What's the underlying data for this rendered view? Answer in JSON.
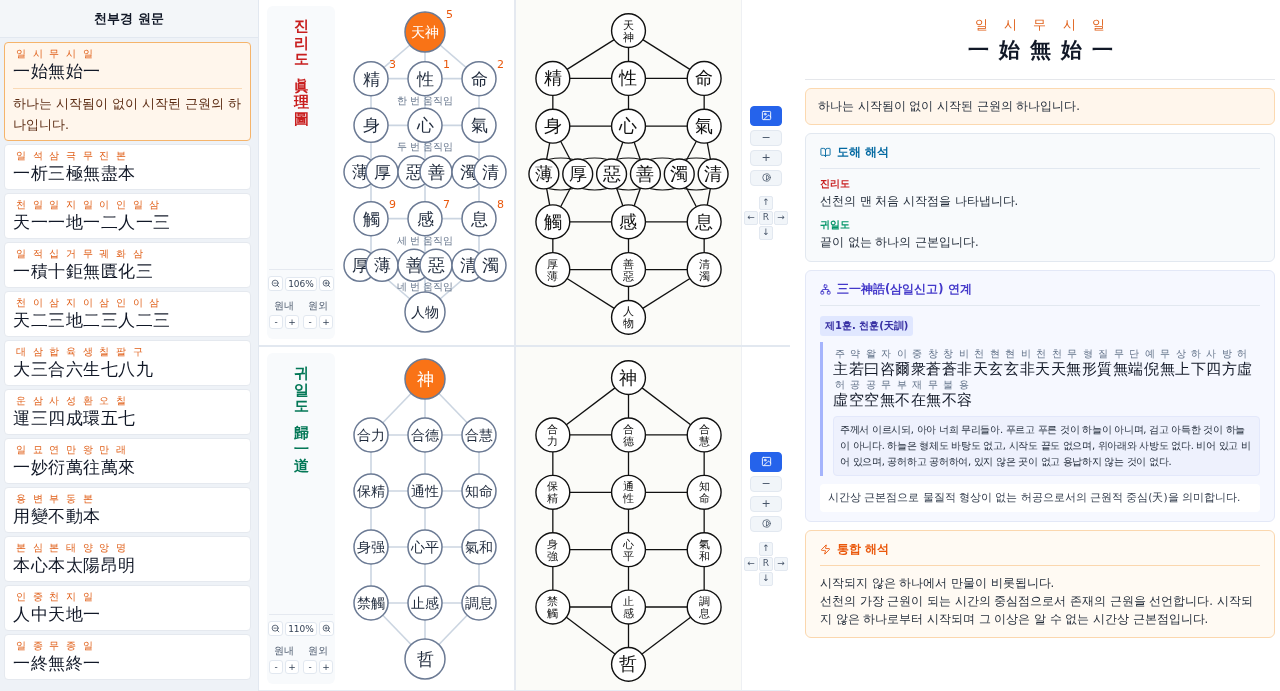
{
  "sidebar": {
    "title": "천부경 원문",
    "verses": [
      {
        "reading": "일 시 무 시 일",
        "hanja": "一始無始一",
        "meaning": "하나는 시작됨이 없이 시작된 근원의 하나입니다.",
        "selected": true
      },
      {
        "reading": "일 석 삼 극 무 진 본",
        "hanja": "一析三極無盡本",
        "selected": false
      },
      {
        "reading": "천 일 일 지 일 이 인 일 삼",
        "hanja": "天一一地一二人一三",
        "selected": false
      },
      {
        "reading": "일 적 십 거 무 궤 화 삼",
        "hanja": "一積十鉅無匱化三",
        "selected": false
      },
      {
        "reading": "천 이 삼 지 이 삼 인 이 삼",
        "hanja": "天二三地二三人二三",
        "selected": false
      },
      {
        "reading": "대 삼 합 육 생 칠 팔 구",
        "hanja": "大三合六生七八九",
        "selected": false
      },
      {
        "reading": "운 삼 사 성 환 오 칠",
        "hanja": "運三四成環五七",
        "selected": false
      },
      {
        "reading": "일 묘 연 만 왕 만 래",
        "hanja": "一妙衍萬往萬來",
        "selected": false
      },
      {
        "reading": "용 변 부 동 본",
        "hanja": "用變不動本",
        "selected": false
      },
      {
        "reading": "본 심 본 태 양 앙 명",
        "hanja": "本心本太陽昂明",
        "selected": false
      },
      {
        "reading": "인 중 천 지 일",
        "hanja": "人中天地一",
        "selected": false
      },
      {
        "reading": "일 종 무 종 일",
        "hanja": "一終無終一",
        "selected": false
      }
    ]
  },
  "panels": [
    {
      "diagram": {
        "title": "진리도",
        "title_hanja": "眞理圖",
        "color": "#c81e1e",
        "zoom": "106%",
        "adjusters": [
          {
            "label": "원내",
            "minus": "-",
            "plus": "+"
          },
          {
            "label": "원외",
            "minus": "-",
            "plus": "+"
          }
        ],
        "rows": [
          {
            "kind": "nodes",
            "groups": [
              [
                {
                  "label": "天神",
                  "badge": "5",
                  "highlight": true
                }
              ]
            ]
          },
          {
            "kind": "nodes",
            "groups": [
              [
                {
                  "label": "精",
                  "badge": "3",
                  "highlight": false
                }
              ],
              [
                {
                  "label": "性",
                  "badge": "1",
                  "highlight": false
                }
              ],
              [
                {
                  "label": "命",
                  "badge": "2",
                  "highlight": false
                }
              ]
            ]
          },
          {
            "kind": "caption",
            "text": "한 번 움직임"
          },
          {
            "kind": "nodes",
            "groups": [
              [
                {
                  "label": "身",
                  "highlight": false
                }
              ],
              [
                {
                  "label": "心",
                  "highlight": false
                }
              ],
              [
                {
                  "label": "氣",
                  "highlight": false
                }
              ]
            ]
          },
          {
            "kind": "caption",
            "text": "두 번 움직임"
          },
          {
            "kind": "nodes",
            "groups": [
              [
                {
                  "label": "薄",
                  "highlight": false
                },
                {
                  "label": "厚",
                  "highlight": false
                }
              ],
              [
                {
                  "label": "惡",
                  "highlight": false
                },
                {
                  "label": "善",
                  "highlight": false
                }
              ],
              [
                {
                  "label": "濁",
                  "highlight": false
                },
                {
                  "label": "清",
                  "highlight": false
                }
              ]
            ]
          },
          {
            "kind": "nodes",
            "groups": [
              [
                {
                  "label": "觸",
                  "badge": "9",
                  "highlight": false
                }
              ],
              [
                {
                  "label": "感",
                  "badge": "7",
                  "highlight": false
                }
              ],
              [
                {
                  "label": "息",
                  "badge": "8",
                  "highlight": false
                }
              ]
            ]
          },
          {
            "kind": "caption",
            "text": "세 번 움직임"
          },
          {
            "kind": "nodes",
            "groups": [
              [
                {
                  "label": "厚",
                  "highlight": false
                },
                {
                  "label": "薄",
                  "highlight": false
                }
              ],
              [
                {
                  "label": "善",
                  "highlight": false
                },
                {
                  "label": "惡",
                  "highlight": false
                }
              ],
              [
                {
                  "label": "清",
                  "highlight": false
                },
                {
                  "label": "濁",
                  "highlight": false
                }
              ]
            ]
          },
          {
            "kind": "caption",
            "text": "네 번 움직임"
          },
          {
            "kind": "nodes",
            "groups": [
              [
                {
                  "label": "人物",
                  "highlight": false
                }
              ]
            ]
          }
        ]
      },
      "scan": {
        "rows": [
          [
            "天神"
          ],
          [
            "精",
            "性",
            "命"
          ],
          [
            "身",
            "心",
            "氣"
          ],
          [
            "薄",
            "厚",
            "惡",
            "善",
            "濁",
            "清"
          ],
          [
            "觸",
            "感",
            "息"
          ],
          [
            "厚薄",
            "善惡",
            "清濁"
          ],
          [
            "人物"
          ]
        ]
      },
      "tools": {
        "image_on": true,
        "minus": "−",
        "plus": "+",
        "pad": [
          "↑",
          "←",
          "R",
          "→",
          "↓"
        ]
      }
    },
    {
      "diagram": {
        "title": "귀일도",
        "title_hanja": "歸一道",
        "color": "#047857",
        "zoom": "110%",
        "adjusters": [
          {
            "label": "원내",
            "minus": "-",
            "plus": "+"
          },
          {
            "label": "원외",
            "minus": "-",
            "plus": "+"
          }
        ],
        "rows": [
          {
            "kind": "nodes",
            "groups": [
              [
                {
                  "label": "神",
                  "highlight": true
                }
              ]
            ]
          },
          {
            "kind": "nodes",
            "groups": [
              [
                {
                  "label": "合力",
                  "highlight": false
                }
              ],
              [
                {
                  "label": "合德",
                  "highlight": false
                }
              ],
              [
                {
                  "label": "合慧",
                  "highlight": false
                }
              ]
            ]
          },
          {
            "kind": "nodes",
            "groups": [
              [
                {
                  "label": "保精",
                  "highlight": false
                }
              ],
              [
                {
                  "label": "通性",
                  "highlight": false
                }
              ],
              [
                {
                  "label": "知命",
                  "highlight": false
                }
              ]
            ]
          },
          {
            "kind": "nodes",
            "groups": [
              [
                {
                  "label": "身强",
                  "highlight": false
                }
              ],
              [
                {
                  "label": "心平",
                  "highlight": false
                }
              ],
              [
                {
                  "label": "氣和",
                  "highlight": false
                }
              ]
            ]
          },
          {
            "kind": "nodes",
            "groups": [
              [
                {
                  "label": "禁觸",
                  "highlight": false
                }
              ],
              [
                {
                  "label": "止感",
                  "highlight": false
                }
              ],
              [
                {
                  "label": "調息",
                  "highlight": false
                }
              ]
            ]
          },
          {
            "kind": "nodes",
            "groups": [
              [
                {
                  "label": "哲",
                  "highlight": false
                }
              ]
            ]
          }
        ]
      },
      "scan": {
        "rows": [
          [
            "神"
          ],
          [
            "合力",
            "合德",
            "合慧"
          ],
          [
            "保精",
            "通性",
            "知命"
          ],
          [
            "身強",
            "心平",
            "氣和"
          ],
          [
            "禁觸",
            "止感",
            "調息"
          ],
          [
            "哲"
          ]
        ]
      },
      "tools": {
        "image_on": true,
        "minus": "−",
        "plus": "+",
        "pad": [
          "↑",
          "←",
          "R",
          "→",
          "↓"
        ]
      }
    }
  ],
  "detail": {
    "reading": "일 시 무 시 일",
    "hanja": "一始無始一",
    "meaning": "하나는 시작됨이 없이 시작된 근원의 하나입니다.",
    "diagram_notes": {
      "title": "도해 해석",
      "items": [
        {
          "label": "진리도",
          "color": "#c81e1e",
          "text": "선천의 맨 처음 시작점을 나타냅니다."
        },
        {
          "label": "귀일도",
          "color": "#059669",
          "text": "끝이 없는 하나의 근본입니다."
        }
      ]
    },
    "samil": {
      "title": "三一神誥(삼일신고) 연계",
      "badge": "제1훈. 천훈(天訓)",
      "lines": [
        {
          "reading": "주 약 왈 자 이 중 창 창 비 천 현 현 비 천 천 무 형 질 무 단 예 무 상 하 사 방 허",
          "hanja": "主若曰咨爾衆蒼蒼非天玄玄非天天無形質無端倪無上下四方虛"
        },
        {
          "reading": "허 공 공 무 부 재 무 불 용",
          "hanja": "虛空空無不在無不容"
        }
      ],
      "translation": "주께서 이르시되, 아아 너희 무리들아. 푸르고 푸른 것이 하늘이 아니며, 검고 아득한 것이 하늘이 아니다. 하늘은 형체도 바탕도 없고, 시작도 끝도 없으며, 위아래와 사방도 없다. 비어 있고 비어 있으며, 공허하고 공허하여, 있지 않은 곳이 없고 용납하지 않는 것이 없다.",
      "note": "시간상 근본점으로 물질적 형상이 없는 허공으로서의 근원적 중심(天)을 의미합니다."
    },
    "integrated": {
      "title": "통합 해석",
      "paragraphs": [
        "시작되지 않은 하나에서 만물이 비롯됩니다.",
        "선천의 가장 근원이 되는 시간의 중심점으로서 존재의 근원을 선언합니다. 시작되지 않은 하나로부터 시작되며 그 이상은 알 수 없는 시간상 근본점입니다."
      ]
    }
  }
}
